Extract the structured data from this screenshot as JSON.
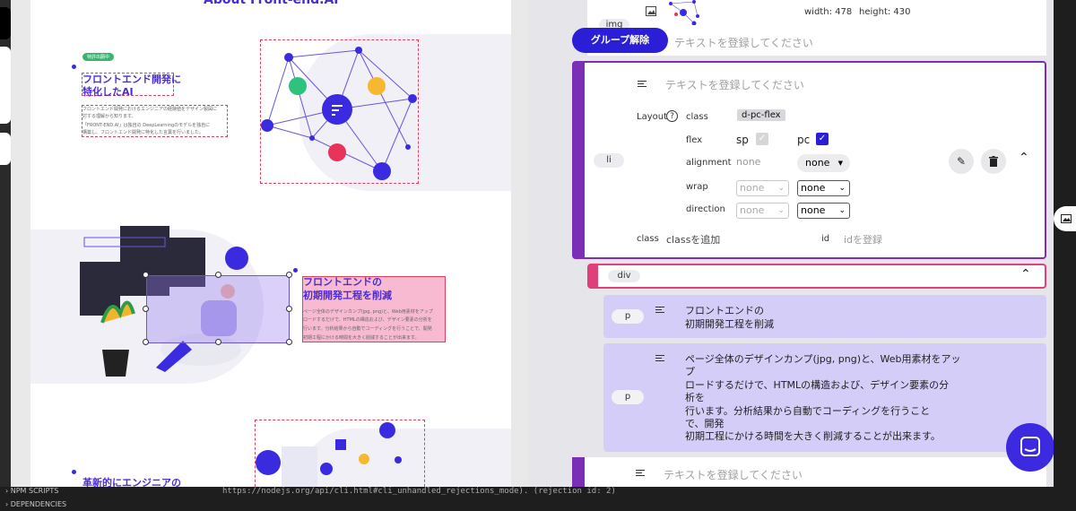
{
  "preview": {
    "heading": "About Front-end.AI",
    "section1": {
      "tag": "特許出願中",
      "title_line1": "フロントエンド開発に",
      "title_line2": "特化したAI",
      "body_line1": "フロントエンド開発におけるエンジニアの経験値をデザイン製図に",
      "body_line2": "対する理解から知ります。",
      "body_line3": "「FRONT-END.AI」は独自の DeepLearningのモデルを独自に",
      "body_line4": "構築し、フロントエンド開発に特化した言葉を行いました。"
    },
    "section2": {
      "title_line1": "フロントエンドの",
      "title_line2": "初期開発工程を削減",
      "body_line1": "ページ全体のデザインカンプ(jpg, png)と、Web用素材をアップ",
      "body_line2": "ロードするだけで、HTMLの構造および、デザイン要素の分析を",
      "body_line3": "行います。分析結果から自動でコーディングを行うことで、開発",
      "body_line4": "初期工程にかける時間を大きく削減することが出来ます。"
    },
    "section3": {
      "title": "革新的にエンジニアの"
    }
  },
  "panel": {
    "img_card": {
      "tag": "img",
      "width_label": "width: 478",
      "height_label": "height: 430",
      "ungroup_button": "グループ解除",
      "text_placeholder": "テキストを登録してください"
    },
    "li_card": {
      "tag": "li",
      "text_placeholder": "テキストを登録してください",
      "layout_label": "Layout",
      "help_icon": "?",
      "class_label": "class",
      "class_value": "d-pc-flex",
      "flex_label": "flex",
      "sp_label": "sp",
      "pc_label": "pc",
      "alignment_label": "alignment",
      "alignment_sp": "none",
      "alignment_pc": "none",
      "wrap_label": "wrap",
      "wrap_sp": "none",
      "wrap_pc": "none",
      "direction_label": "direction",
      "direction_sp": "none",
      "direction_pc": "none",
      "bottom_class_label": "class",
      "bottom_class_placeholder": "classを追加",
      "id_label": "id",
      "id_placeholder": "idを登録",
      "sp_checked": true,
      "pc_checked": true
    },
    "div_card": {
      "tag": "div"
    },
    "p1": {
      "tag": "p",
      "line1": "フロントエンドの",
      "line2": "初期開発工程を削減"
    },
    "p2": {
      "tag": "p",
      "line1": "ページ全体のデザインカンプ(jpg, png)と、Web用素材をアッ",
      "line2": "プ",
      "line3": "ロードするだけで、HTMLの構造および、デザイン要素の分",
      "line4": "析を",
      "line5": "行います。分析結果から自動でコーディングを行うこと",
      "line6": "で、開発",
      "line7": "初期工程にかける時間を大きく削減することが出来ます。"
    },
    "bottom_card": {
      "text_placeholder": "テキストを登録してください"
    }
  },
  "terminal": {
    "npm_scripts": "NPM SCRIPTS",
    "dependencies": "DEPENDENCIES",
    "log_line": "https://nodejs.org/api/cli.html#cli_unhandled_rejections_mode). (rejection id: 2)"
  },
  "colors": {
    "accent_blue": "#2a1fd6",
    "purple_border": "#7b2fb5",
    "pink_border": "#e0407a",
    "p_card_bg": "#d4cdf7",
    "chat_button": "#3b2ae0"
  }
}
